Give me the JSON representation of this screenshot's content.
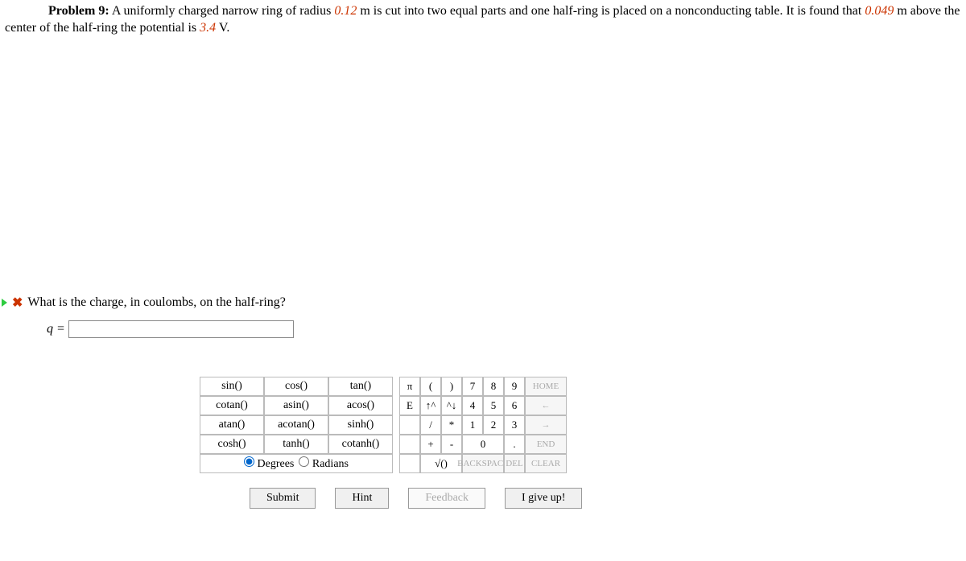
{
  "problem": {
    "label": "Problem 9:",
    "text_before_r": "A uniformly charged narrow ring of radius ",
    "radius": "0.12",
    "text_after_r": " m is cut into two equal parts and one half-ring is placed on a nonconducting table. It is found that ",
    "height": "0.049",
    "text_after_h": " m above the center of the half-ring the potential is ",
    "potential": "3.4",
    "text_end": " V."
  },
  "question": "What is the charge, in coulombs, on the half-ring?",
  "answer_prefix": "q = ",
  "answer_value": "",
  "func": {
    "sin": "sin()",
    "cos": "cos()",
    "tan": "tan()",
    "cotan": "cotan()",
    "asin": "asin()",
    "acos": "acos()",
    "atan": "atan()",
    "acotan": "acotan()",
    "sinh": "sinh()",
    "cosh": "cosh()",
    "tanh": "tanh()",
    "cotanh": "cotanh()"
  },
  "mode": {
    "degrees": "Degrees",
    "radians": "Radians"
  },
  "key": {
    "pi": "π",
    "lp": "(",
    "rp": ")",
    "7": "7",
    "8": "8",
    "9": "9",
    "home": "HOME",
    "E": "E",
    "up": "↑^",
    "down": "^↓",
    "4": "4",
    "5": "5",
    "6": "6",
    "left": "←",
    "slash": "/",
    "star": "*",
    "1": "1",
    "2": "2",
    "3": "3",
    "right": "→",
    "plus": "+",
    "minus": "-",
    "0": "0",
    "dot": ".",
    "end": "END",
    "sqrt": "√()",
    "backspace": "BACKSPACE",
    "del": "DEL",
    "clear": "CLEAR"
  },
  "actions": {
    "submit": "Submit",
    "hint": "Hint",
    "feedback": "Feedback",
    "giveup": "I give up!"
  }
}
